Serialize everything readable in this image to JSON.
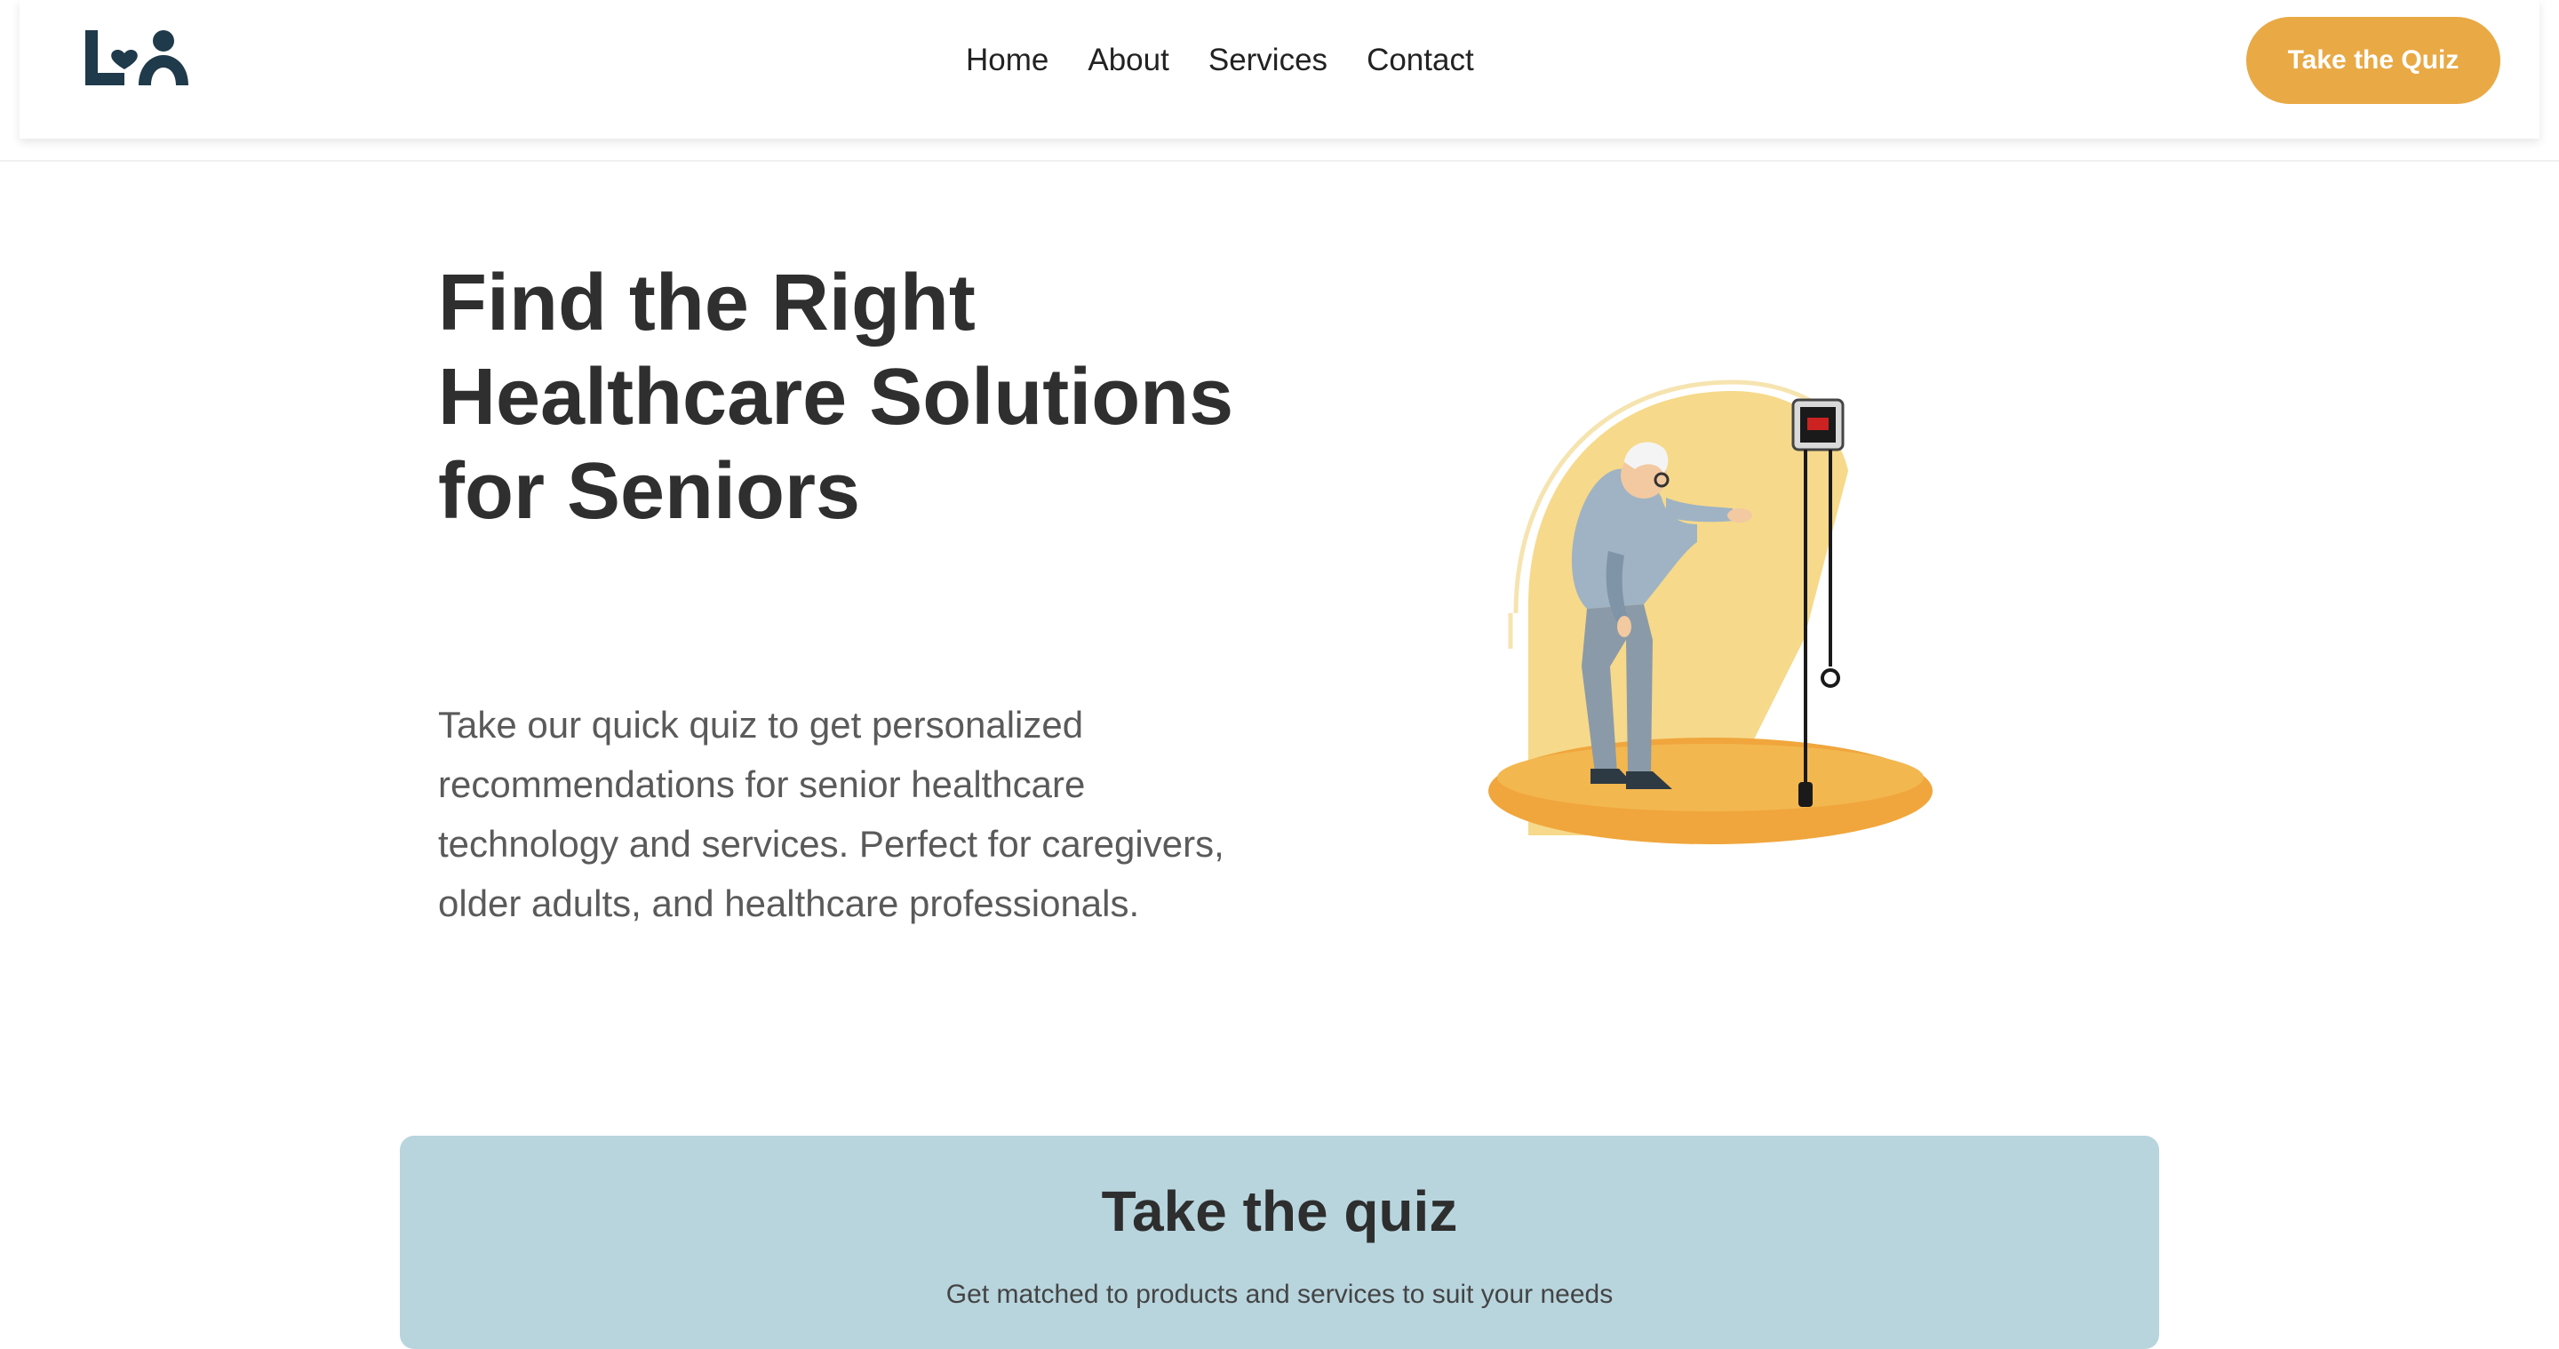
{
  "nav": {
    "items": [
      "Home",
      "About",
      "Services",
      "Contact"
    ],
    "cta_label": "Take the Quiz"
  },
  "hero": {
    "title_lines": [
      "Find the Right",
      "Healthcare Solutions",
      "for Seniors"
    ],
    "description": "Take our quick quiz to get personalized recommendations for senior healthcare technology and services. Perfect for caregivers, older adults, and healthcare professionals.",
    "illustration_icon": "senior-with-medical-alert-illustration"
  },
  "quiz_card": {
    "title": "Take the quiz",
    "subtitle": "Get matched to products and services to suit your needs"
  },
  "colors": {
    "brand_dark": "#1f3a4a",
    "accent": "#e9a945",
    "card_bg": "#b8d5de",
    "illustration_yellow": "#f6d98a",
    "illustration_orange": "#f0a63c"
  }
}
